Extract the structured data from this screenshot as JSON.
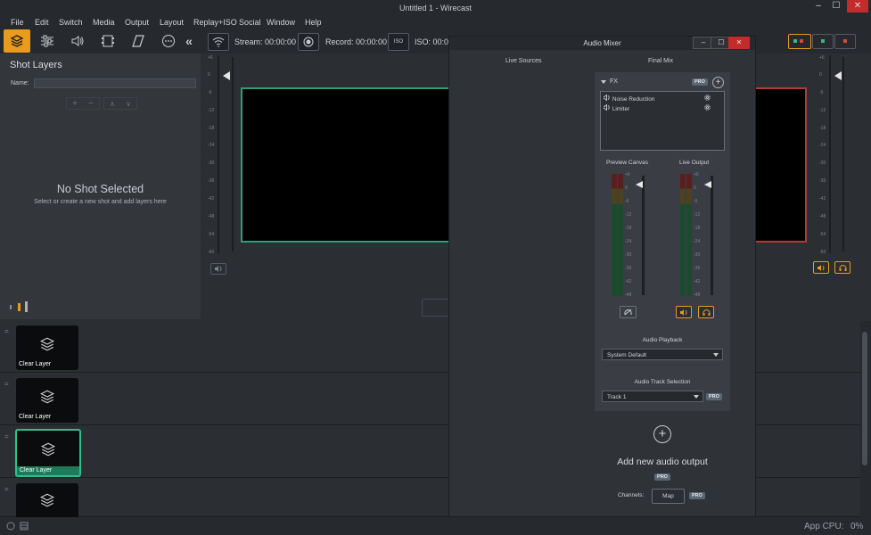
{
  "window": {
    "title": "Untitled 1 - Wirecast",
    "minimize": "–",
    "maximize": "☐",
    "close": "✕"
  },
  "menu": [
    "File",
    "Edit",
    "Switch",
    "Media",
    "Output",
    "Layout",
    "Replay+ISO",
    "Social",
    "Window",
    "Help"
  ],
  "toolbar": {
    "icons": [
      "layers-icon",
      "sliders-icon",
      "speaker-icon",
      "film-icon",
      "parallelogram-icon",
      "more-icon"
    ],
    "collapse": "«"
  },
  "status": {
    "stream": "Stream: 00:00:00",
    "record": "Record: 00:00:00",
    "iso": "ISO: 00:0",
    "iso_badge": "ISO"
  },
  "shot_layers": {
    "title": "Shot Layers",
    "name_label": "Name:",
    "name_value": "",
    "no_shot_title": "No Shot Selected",
    "no_shot_sub": "Select or create a new shot and add layers here"
  },
  "meter_scale": [
    "+6",
    "0",
    "-6",
    "-12",
    "-18",
    "-24",
    "-30",
    "-36",
    "-42",
    "-48",
    "-54",
    "-60"
  ],
  "mini_scale": [
    "+6",
    "0",
    "-6",
    "-12",
    "-18",
    "-24",
    "-30",
    "-36",
    "-42",
    "-48"
  ],
  "layers": [
    {
      "label": "Clear Layer",
      "selected": false
    },
    {
      "label": "Clear Layer",
      "selected": false
    },
    {
      "label": "Clear Layer",
      "selected": true
    },
    {
      "label": "",
      "selected": false
    }
  ],
  "mixer": {
    "title": "Audio Mixer",
    "live_sources": "Live Sources",
    "final_mix": "Final Mix",
    "fx_label": "FX",
    "pro": "PRO",
    "fx_items": [
      "Noise Reduction",
      "Limiter"
    ],
    "preview_canvas": "Preview Canvas",
    "live_output": "Live Output",
    "audio_playback": "Audio Playback",
    "playback_value": "System Default",
    "track_selection": "Audio Track Selection",
    "track_value": "Track 1",
    "add_output": "Add new audio output",
    "channels_label": "Channels:",
    "map_button": "Map"
  },
  "bottom": {
    "cpu": "App CPU:",
    "cpu_value": "0%"
  },
  "colors": {
    "accent": "#e89b1c",
    "preview_border": "#2f9c7a",
    "live_border": "#b33a3a"
  }
}
